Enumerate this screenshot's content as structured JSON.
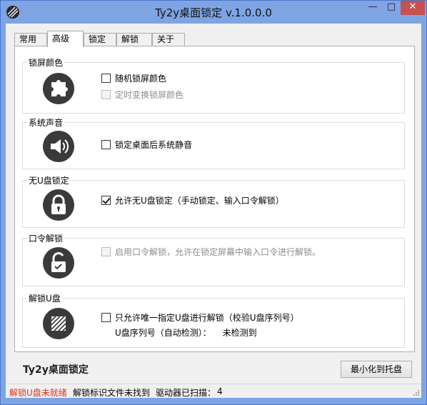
{
  "window": {
    "title": "Ty2y桌面锁定 v.1.0.0.0",
    "minimize_glyph": "—",
    "maximize_glyph": "□",
    "close_glyph": "✕"
  },
  "tabs": [
    {
      "label": "常用"
    },
    {
      "label": "高级"
    },
    {
      "label": "锁定"
    },
    {
      "label": "解锁"
    },
    {
      "label": "关于"
    }
  ],
  "active_tab": "高级",
  "groups": {
    "lock_color": {
      "title": "锁屏颜色",
      "icon": "puzzle-icon",
      "options": [
        {
          "label": "随机锁屏颜色",
          "checked": false,
          "enabled": true
        },
        {
          "label": "定时变换锁屏颜色",
          "checked": false,
          "enabled": false
        }
      ]
    },
    "sound": {
      "title": "系统声音",
      "icon": "speaker-icon",
      "options": [
        {
          "label": "锁定桌面后系统静音",
          "checked": false,
          "enabled": true
        }
      ]
    },
    "no_usb": {
      "title": "无U盘锁定",
      "icon": "padlock-closed-icon",
      "options": [
        {
          "label": "允许无U盘锁定（手动锁定、输入口令解锁）",
          "checked": true,
          "enabled": true
        }
      ]
    },
    "password": {
      "title": "口令解锁",
      "icon": "padlock-open-icon",
      "options": [
        {
          "label": "启用口令解锁，允许在锁定屏幕中输入口令进行解锁。",
          "checked": false,
          "enabled": false
        }
      ]
    },
    "unlock_usb": {
      "title": "解锁U盘",
      "icon": "usb-drive-icon",
      "options": [
        {
          "label": "只允许唯一指定U盘进行解锁（校验U盘序列号）",
          "checked": false,
          "enabled": true
        }
      ],
      "serial_label": "U盘序列号（自动检测）：",
      "serial_value": "未检测到"
    }
  },
  "footer": {
    "brand": "Ty2y桌面锁定",
    "tray_button": "最小化到托盘"
  },
  "statusbar": {
    "usb_status": "解锁U盘未就绪",
    "file_status": "解锁标识文件未找到",
    "drives_label": "驱动器已扫描：",
    "drives_count": "4"
  },
  "colors": {
    "titlebar": "#7fa4e4",
    "close_button": "#c75050",
    "status_error": "#e0301e",
    "icon_dark": "#3a3a3a"
  }
}
